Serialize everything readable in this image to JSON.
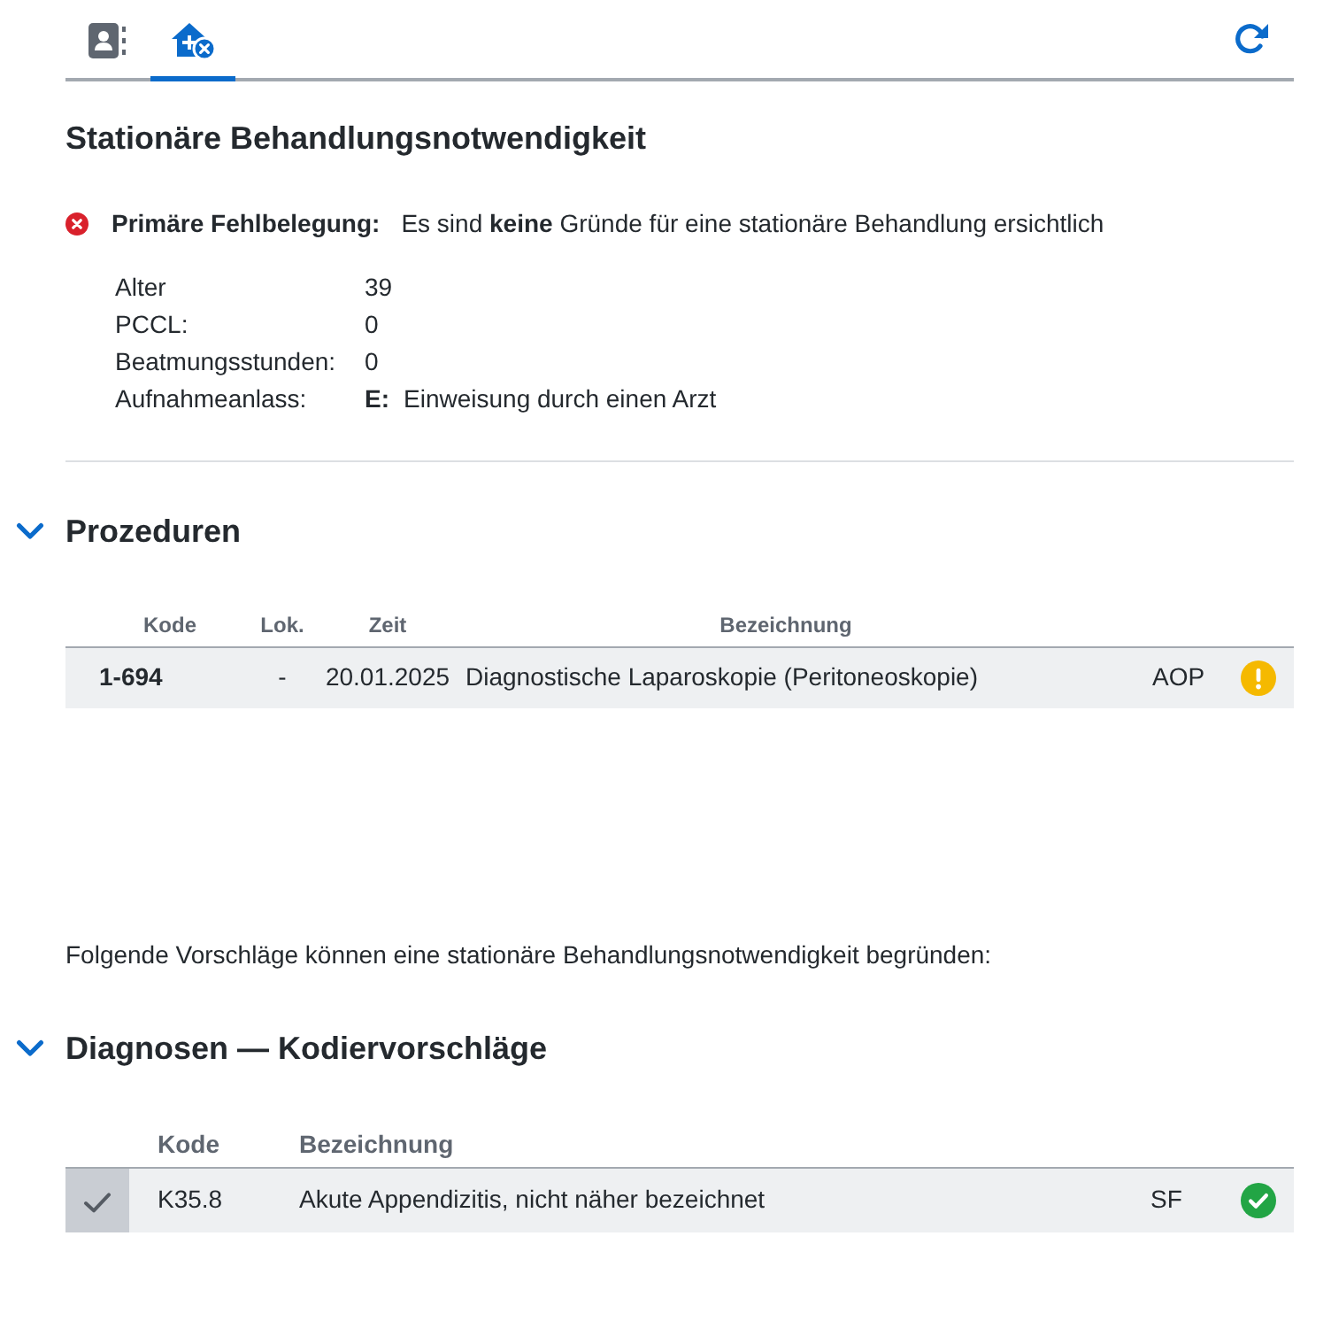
{
  "tabs": [
    {
      "kind": "contacts",
      "selected": false
    },
    {
      "kind": "hospital",
      "selected": true
    }
  ],
  "title": "Stationäre Behandlungsnotwendigkeit",
  "alert": {
    "kind": "error",
    "label": "Primäre Fehlbelegung:",
    "message": "Es sind **keine** Gründe für eine stationäre Behandlung ersichtlich"
  },
  "facts": [
    {
      "label": "Alter",
      "value": "39"
    },
    {
      "label": "PCCL:",
      "value": "0"
    },
    {
      "label": "Beatmungsstunden:",
      "value": "0"
    },
    {
      "label": "Aufnahmeanlass:",
      "code": "E:",
      "value": "Einweisung durch einen Arzt"
    }
  ],
  "procedures": {
    "title": "Prozeduren",
    "expanded": true,
    "columns": [
      "Kode",
      "Lok.",
      "Zeit",
      "Bezeichnung"
    ],
    "rows": [
      {
        "kind": "warning",
        "code": "1-694",
        "location": "-",
        "time": "20.01.2025",
        "name": "Diagnostische Laparoskopie (Peritoneoskopie)",
        "tag": "AOP"
      }
    ]
  },
  "note": "Folgende Vorschläge können eine stationäre Behandlungsnotwendigkeit begründen:",
  "diagnoses": {
    "title": "Diagnosen — Kodiervorschläge",
    "expanded": true,
    "columns": [
      "Kode",
      "Bezeichnung"
    ],
    "rows": [
      {
        "kind": "ok",
        "checked": true,
        "code": "K35.8",
        "name": "Akute Appendizitis, nicht näher bezeichnet",
        "tag": "SF"
      }
    ]
  }
}
